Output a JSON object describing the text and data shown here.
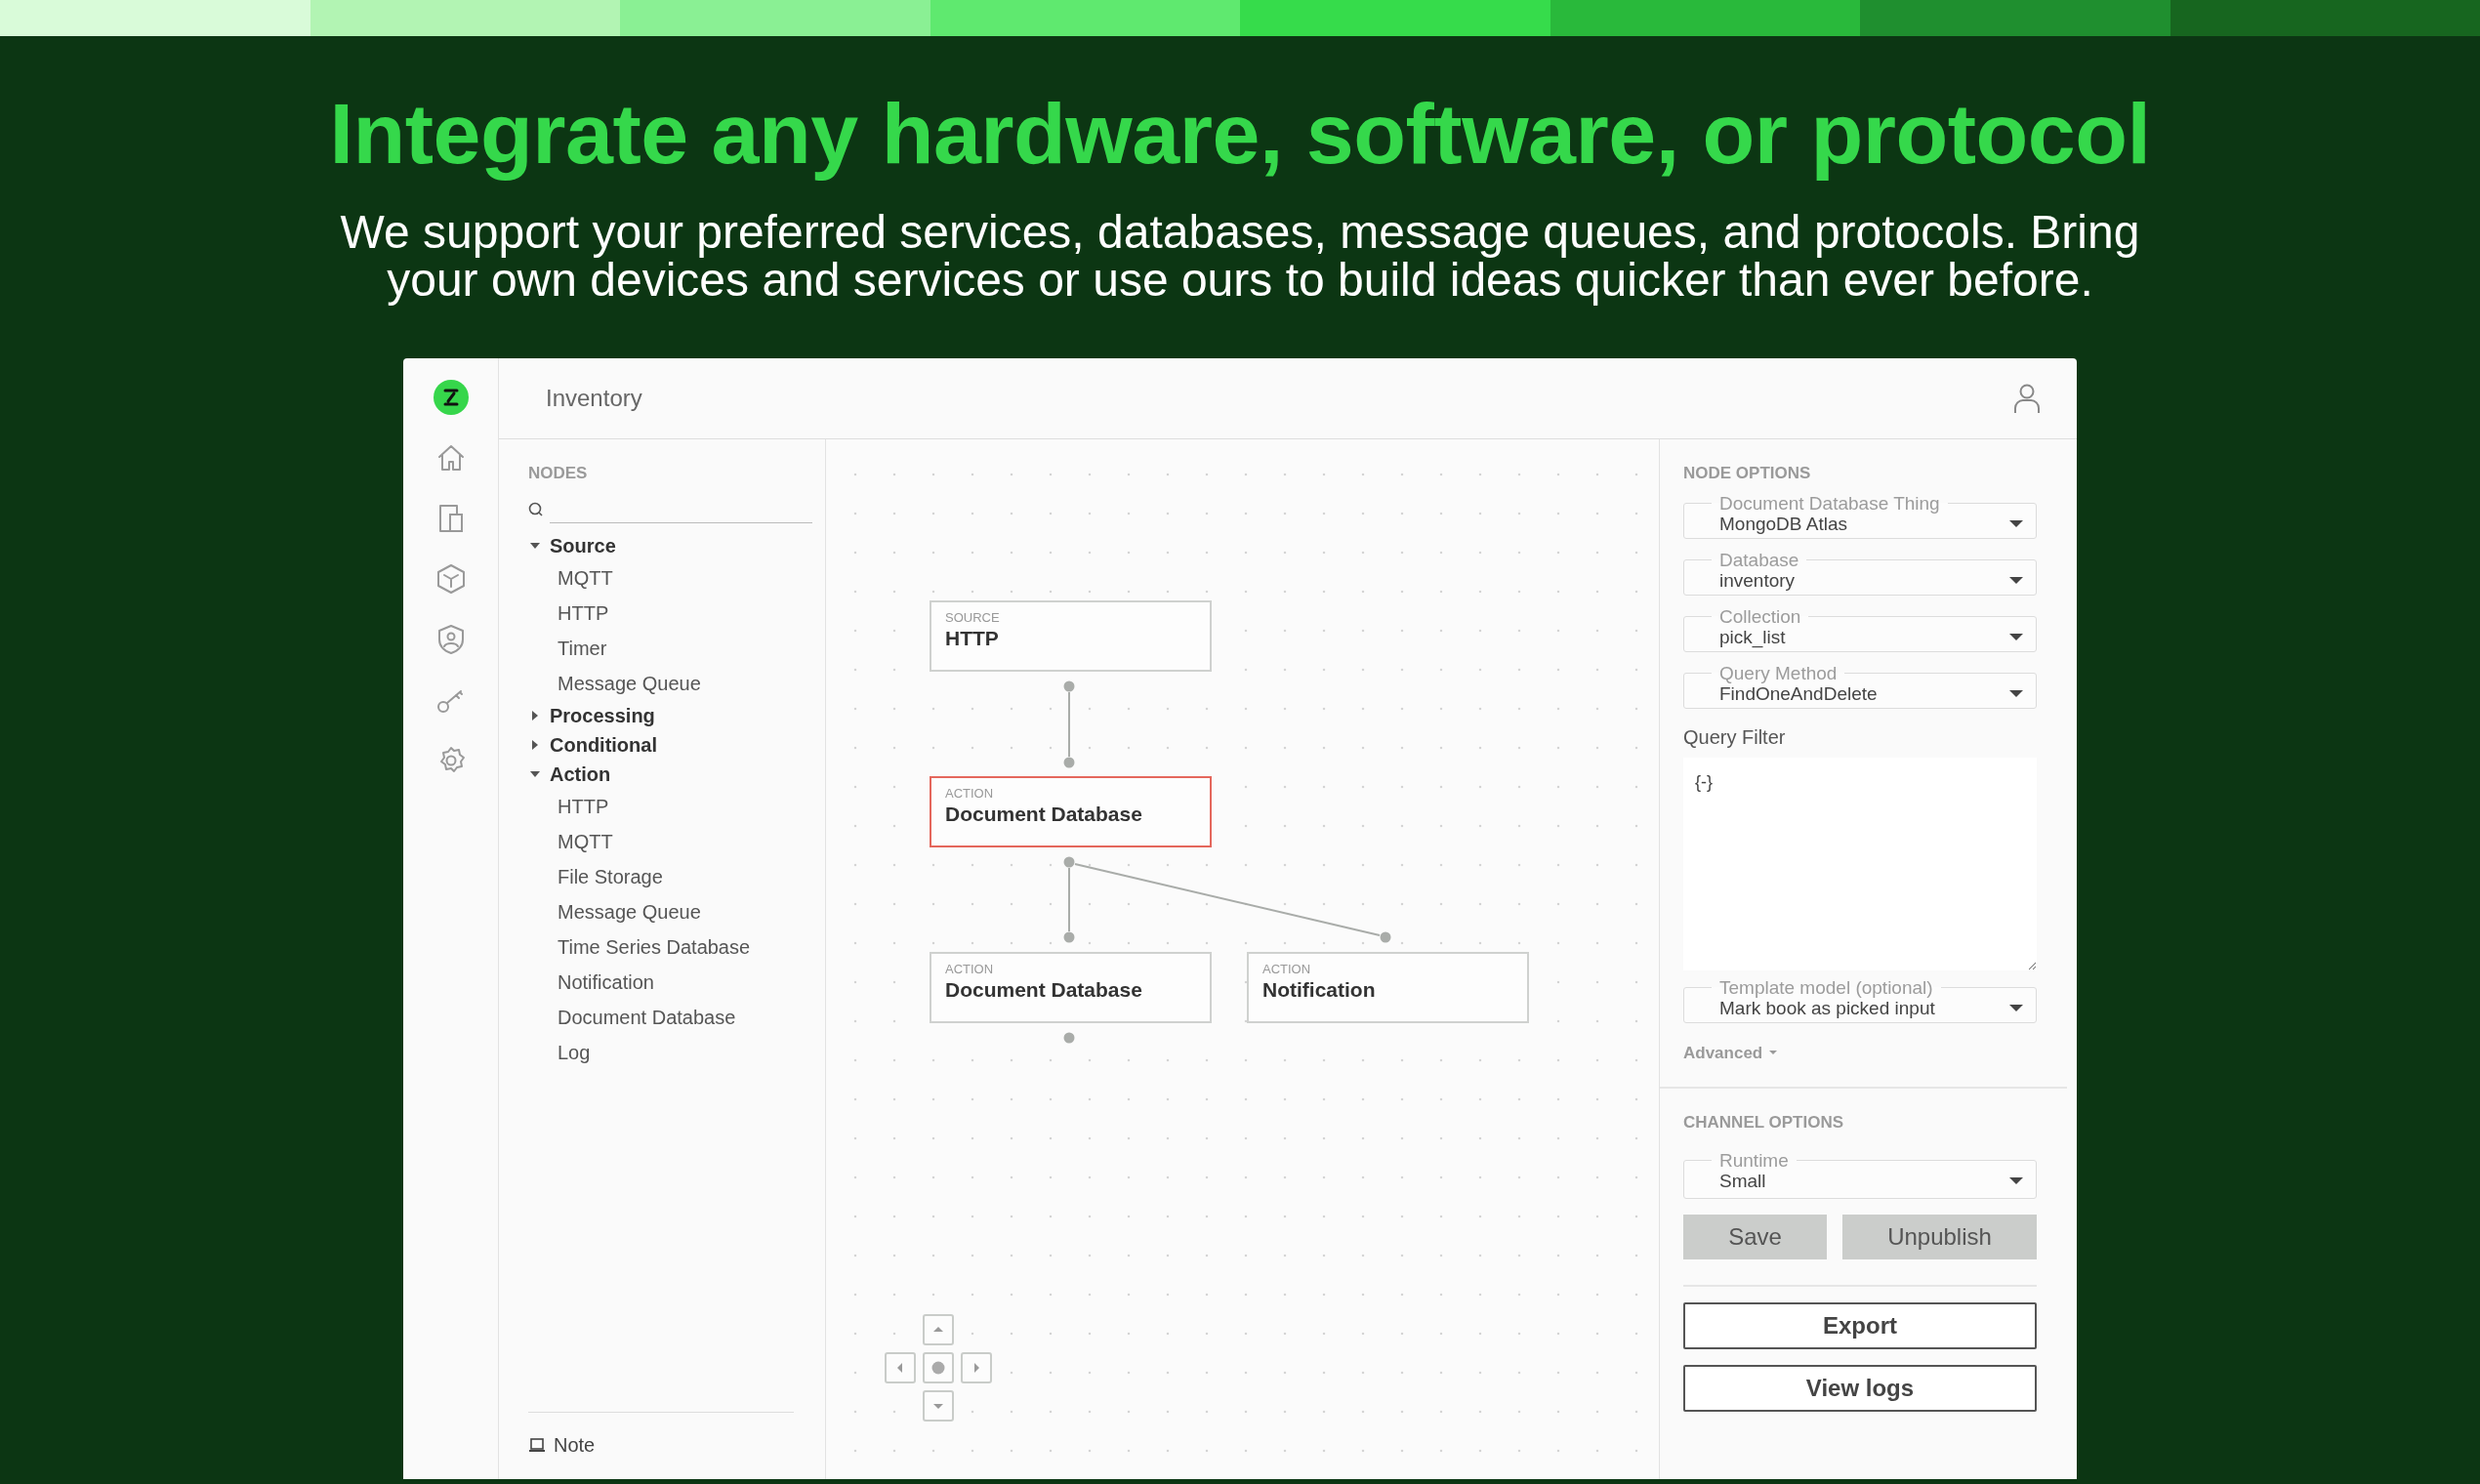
{
  "headline": "Integrate any hardware, software, or protocol",
  "subheadline": "We support your preferred services, databases, message queues, and protocols. Bring your own devices and services or use ours to build ideas quicker than ever before.",
  "app": {
    "header_title": "Inventory",
    "nodes_panel": {
      "heading": "NODES",
      "groups": [
        {
          "label": "Source",
          "expanded": true,
          "children": [
            {
              "label": "MQTT"
            },
            {
              "label": "HTTP"
            },
            {
              "label": "Timer"
            },
            {
              "label": "Message Queue"
            }
          ]
        },
        {
          "label": "Processing",
          "expanded": false
        },
        {
          "label": "Conditional",
          "expanded": false
        },
        {
          "label": "Action",
          "expanded": true,
          "children": [
            {
              "label": "HTTP"
            },
            {
              "label": "MQTT"
            },
            {
              "label": "File Storage"
            },
            {
              "label": "Message Queue"
            },
            {
              "label": "Time Series Database"
            },
            {
              "label": "Notification"
            },
            {
              "label": "Document Database"
            },
            {
              "label": "Log"
            }
          ]
        }
      ],
      "note": "Note"
    },
    "canvas": {
      "nodes": [
        {
          "category": "SOURCE",
          "title": "HTTP",
          "selected": false
        },
        {
          "category": "ACTION",
          "title": "Document Database",
          "selected": true
        },
        {
          "category": "ACTION",
          "title": "Document Database",
          "selected": false
        },
        {
          "category": "ACTION",
          "title": "Notification",
          "selected": false
        }
      ]
    },
    "node_options": {
      "heading": "NODE OPTIONS",
      "selects": [
        {
          "label": "Document Database Thing",
          "value": "MongoDB Atlas"
        },
        {
          "label": "Database",
          "value": "inventory"
        },
        {
          "label": "Collection",
          "value": "pick_list"
        },
        {
          "label": "Query Method",
          "value": "FindOneAndDelete"
        }
      ],
      "query_filter": {
        "label": "Query Filter",
        "value": "{-}"
      },
      "template_select": {
        "label": "Template model (optional)",
        "value": "Mark book as picked input"
      },
      "advanced": "Advanced"
    },
    "channel_options": {
      "heading": "CHANNEL OPTIONS",
      "runtime": {
        "label": "Runtime",
        "value": "Small"
      },
      "buttons": [
        {
          "label": "Save",
          "disabled": true
        },
        {
          "label": "Unpublish",
          "disabled": true
        }
      ],
      "export": "Export",
      "view_logs": "View logs"
    }
  }
}
